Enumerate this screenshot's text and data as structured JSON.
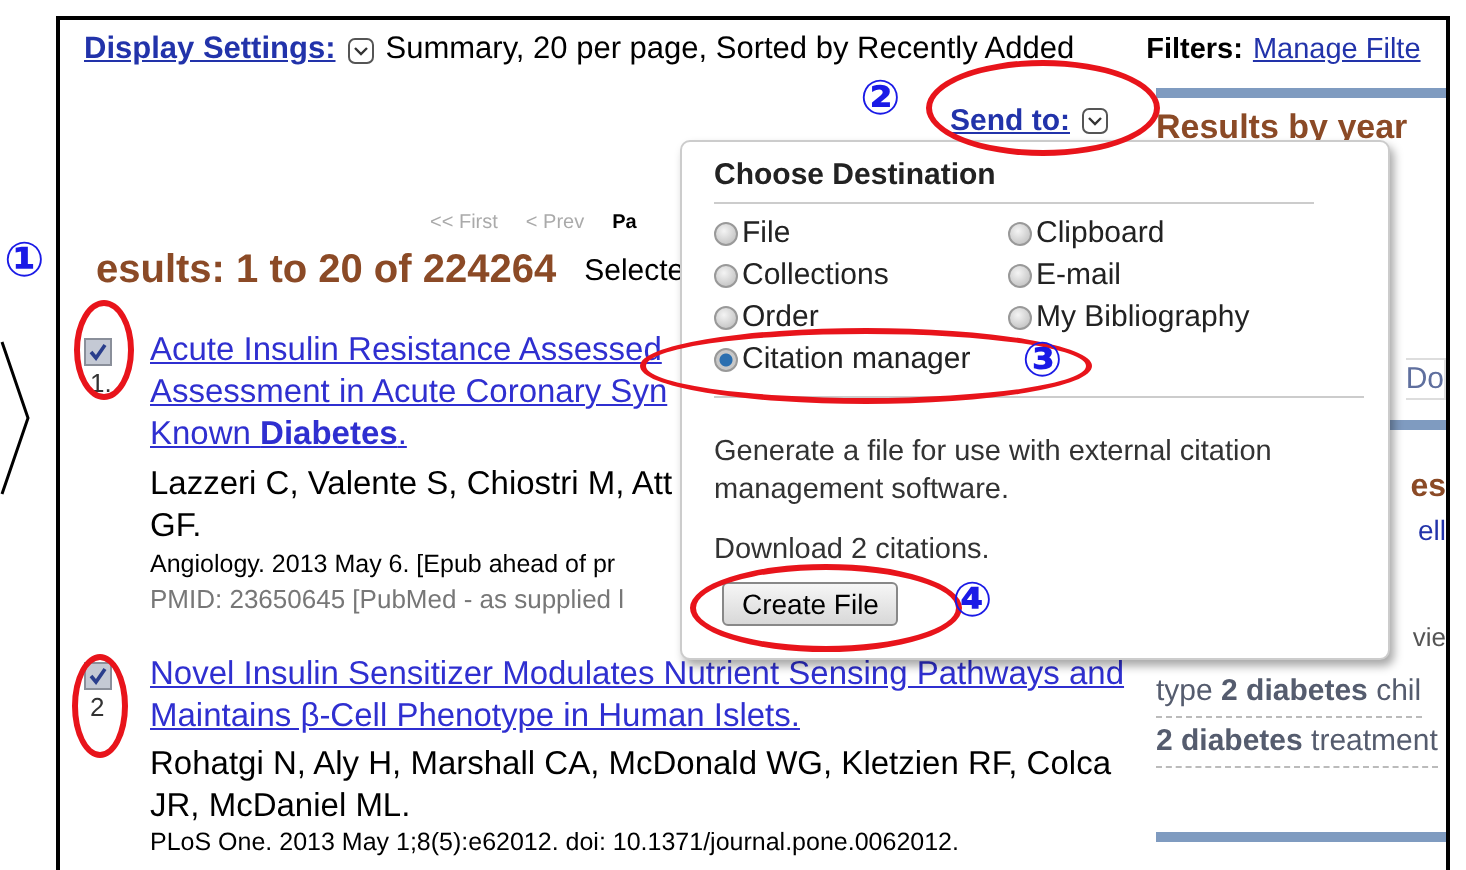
{
  "display_settings": {
    "label": "Display Settings:",
    "value": "Summary, 20 per page, Sorted by Recently Added"
  },
  "filters": {
    "label": "Filters:",
    "link": "Manage Filte"
  },
  "send_to": {
    "label": "Send to:"
  },
  "pagination": [
    {
      "label": "<< First",
      "selected": false
    },
    {
      "label": "< Prev",
      "selected": false
    },
    {
      "label": "Pa",
      "selected": true
    }
  ],
  "results": {
    "title": "esults: 1 to 20 of 224264",
    "selected_label": "Selecte"
  },
  "items": [
    {
      "number": "1.",
      "checked": true,
      "title_lines": [
        "Acute Insulin Resistance Assessed",
        "Assessment in Acute Coronary Syn",
        "Known **Diabetes**."
      ],
      "author_lines": [
        "Lazzeri C, Valente S, Chiostri M, Att",
        "GF."
      ],
      "journal": "Angiology. 2013 May 6. [Epub ahead of pr",
      "pmid": "PMID: 23650645 [PubMed - as supplied l"
    },
    {
      "number": "2",
      "checked": true,
      "title_lines": [
        "Novel Insulin Sensitizer Modulates Nutrient Sensing Pathways and",
        "Maintains β-Cell Phenotype in Human Islets."
      ],
      "author_lines": [
        "Rohatgi N, Aly H, Marshall CA, McDonald WG, Kletzien RF, Colca",
        "JR, McDaniel ML."
      ],
      "journal": "PLoS One. 2013 May 1;8(5):e62012. doi: 10.1371/journal.pone.0062012."
    }
  ],
  "sidebar": {
    "heading": "Results by year",
    "box_text": "Do",
    "section_heading": "es",
    "link": "ell",
    "text": "vie",
    "suggestions": [
      "type **2 diabetes** chil",
      "**2 diabetes** treatment"
    ]
  },
  "popup": {
    "title": "Choose Destination",
    "options": [
      {
        "label": "File",
        "selected": false
      },
      {
        "label": "Clipboard",
        "selected": false
      },
      {
        "label": "Collections",
        "selected": false
      },
      {
        "label": "E-mail",
        "selected": false
      },
      {
        "label": "Order",
        "selected": false
      },
      {
        "label": "My Bibliography",
        "selected": false
      },
      {
        "label": "Citation manager",
        "selected": true
      }
    ],
    "description": "Generate a file for use with external citation management software.",
    "download": "Download 2 citations.",
    "button": "Create File"
  },
  "annotations": [
    {
      "label": "①"
    },
    {
      "label": "②"
    },
    {
      "label": "③"
    },
    {
      "label": "④"
    }
  ]
}
